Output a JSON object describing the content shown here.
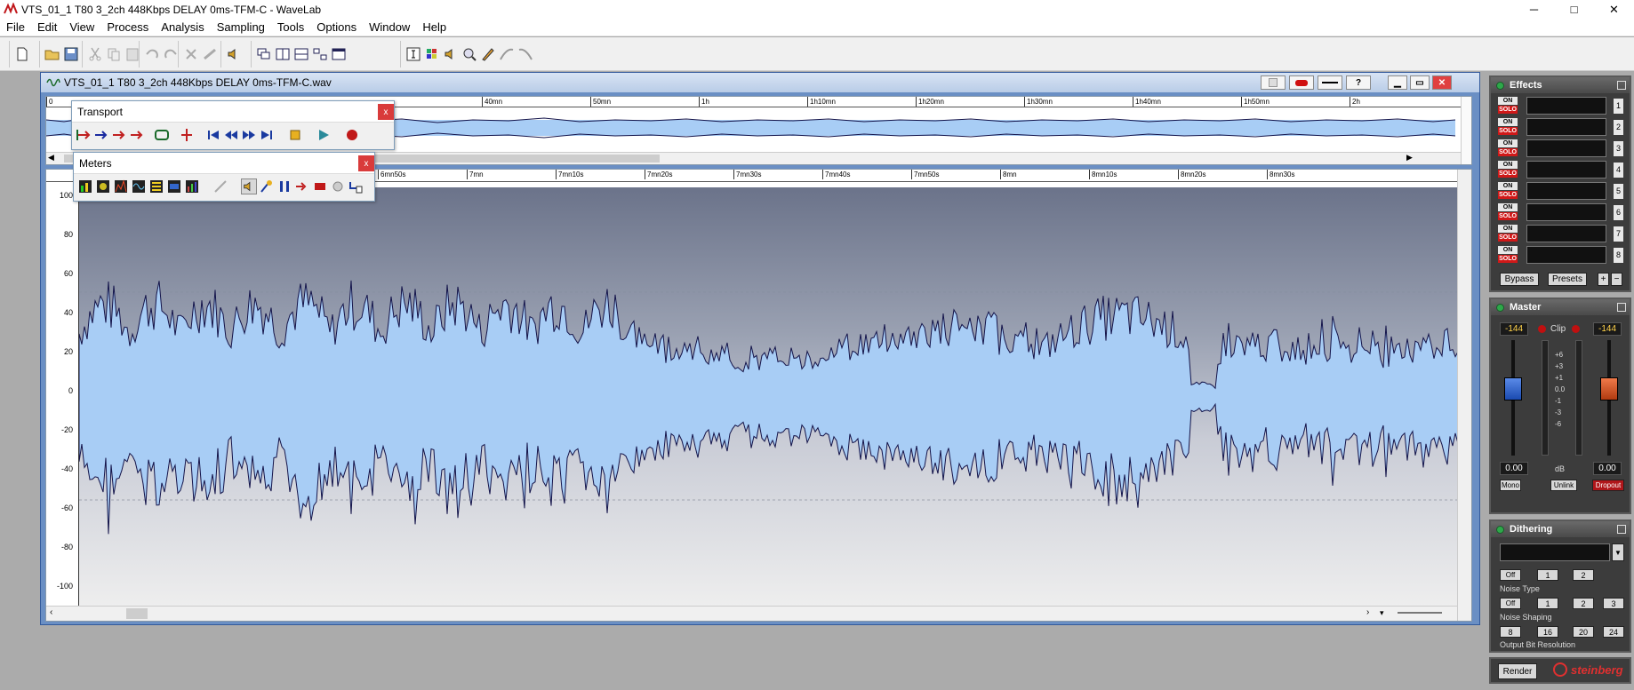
{
  "app": {
    "title": "VTS_01_1 T80 3_2ch 448Kbps DELAY 0ms-TFM-C - WaveLab",
    "minimize": "─",
    "maximize": "□",
    "close": "✕"
  },
  "menu": [
    "File",
    "Edit",
    "View",
    "Process",
    "Analysis",
    "Sampling",
    "Tools",
    "Options",
    "Window",
    "Help"
  ],
  "document": {
    "title": "VTS_01_1 T80 3_2ch 448Kbps DELAY 0ms-TFM-C.wav",
    "btn_help": "?"
  },
  "overview_ruler": [
    "0",
    "40mn",
    "50mn",
    "1h",
    "1h10mn",
    "1h20mn",
    "1h30mn",
    "1h40mn",
    "1h50mn",
    "2h"
  ],
  "main_ruler": [
    "6mn50s",
    "7mn",
    "7mn10s",
    "7mn20s",
    "7mn30s",
    "7mn40s",
    "7mn50s",
    "8mn",
    "8mn10s",
    "8mn20s",
    "8mn30s"
  ],
  "y_axis": [
    "100",
    "80",
    "60",
    "40",
    "20",
    "0",
    "-20",
    "-40",
    "-60",
    "-80",
    "-100"
  ],
  "transport": {
    "title": "Transport",
    "close": "x"
  },
  "meters": {
    "title": "Meters",
    "close": "x"
  },
  "effects": {
    "title": "Effects",
    "slots": [
      "1",
      "2",
      "3",
      "4",
      "5",
      "6",
      "7",
      "8"
    ],
    "on_label": "ON",
    "solo_label": "SOLO",
    "bypass": "Bypass",
    "presets": "Presets",
    "plus": "+",
    "minus": "−"
  },
  "master": {
    "title": "Master",
    "left_peak": "-144",
    "right_peak": "-144",
    "clip": "Clip",
    "scale": [
      "+6",
      "+3",
      "+1",
      "0.0",
      "-1",
      "-3",
      "-6"
    ],
    "left_gain": "0.00",
    "right_gain": "0.00",
    "db": "dB",
    "mono": "Mono",
    "unlink": "Unlink",
    "dropout": "Dropout"
  },
  "dithering": {
    "title": "Dithering",
    "noise_type_btns": [
      "Off",
      "1",
      "2"
    ],
    "noise_type_label": "Noise  Type",
    "shaping_btns": [
      "Off",
      "1",
      "2",
      "3"
    ],
    "shaping_label": "Noise  Shaping",
    "bits": [
      "8",
      "16",
      "20",
      "24"
    ],
    "bits_label": "Output Bit Resolution"
  },
  "footer": {
    "render": "Render",
    "brand": "steinberg"
  },
  "colors": {
    "accent": "#335a9b",
    "wave_fill": "#a8cdf5",
    "wave_line": "#14144a",
    "led": "#2ea84a",
    "dropout": "#b0161a"
  }
}
